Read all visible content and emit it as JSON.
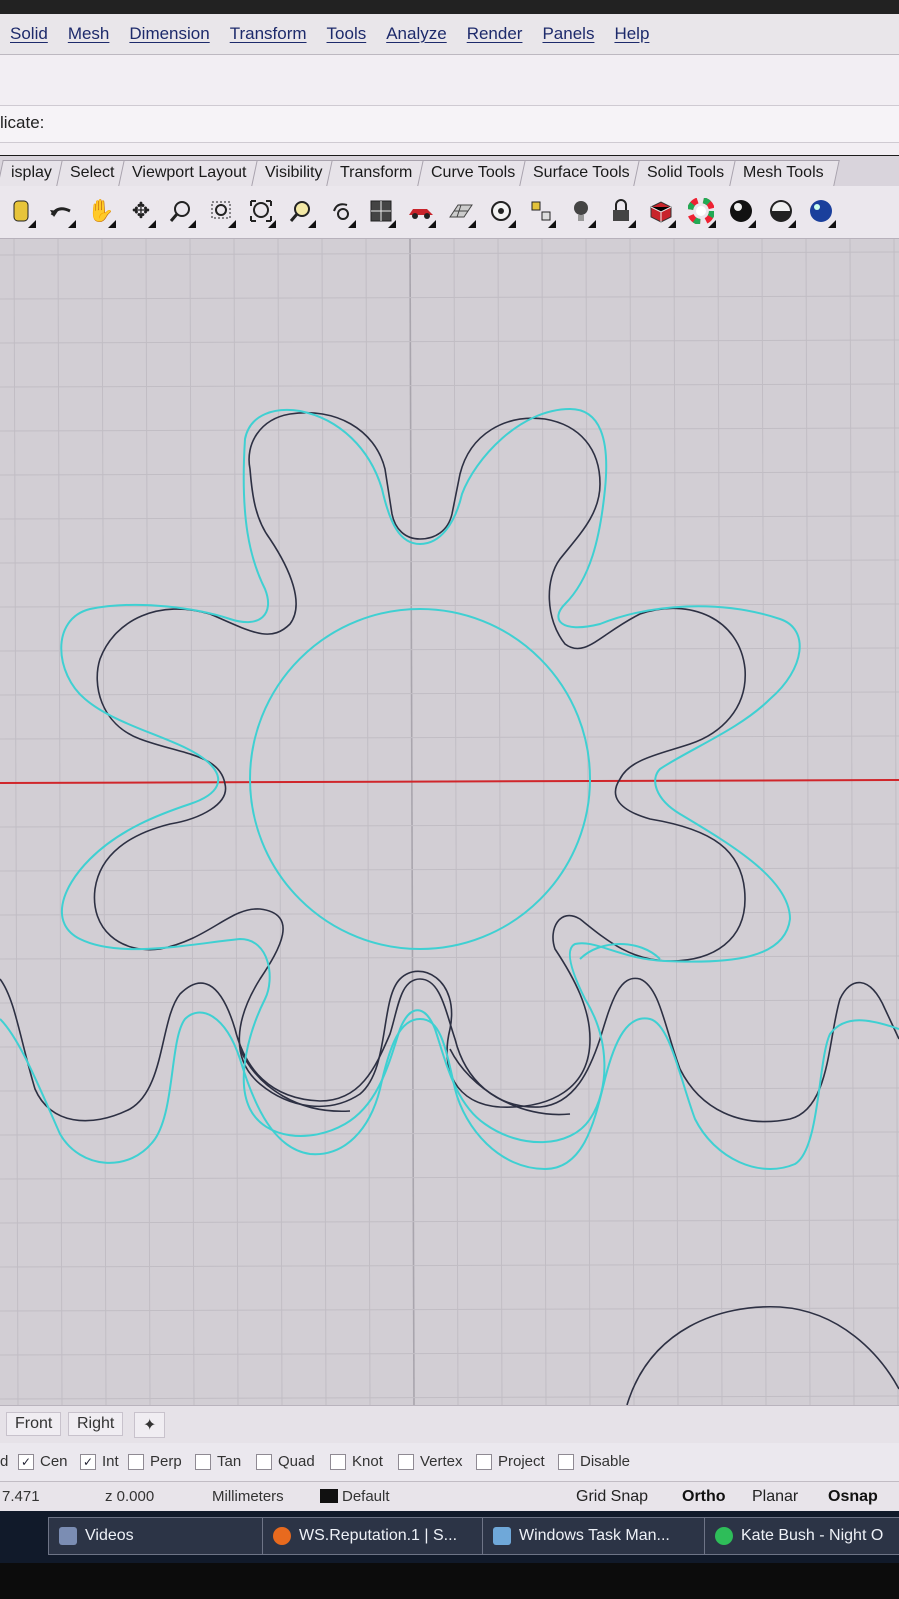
{
  "menu": {
    "items": [
      "Solid",
      "Mesh",
      "Dimension",
      "Transform",
      "Tools",
      "Analyze",
      "Render",
      "Panels",
      "Help"
    ]
  },
  "command": {
    "prompt": "licate:"
  },
  "toolbar_tabs": [
    "isplay",
    "Select",
    "Viewport Layout",
    "Visibility",
    "Transform",
    "Curve Tools",
    "Surface Tools",
    "Solid Tools",
    "Mesh Tools"
  ],
  "toolbar_icons": [
    "new-icon",
    "undo-icon",
    "pan-hand-icon",
    "rotate-view-icon",
    "zoom-dynamic-icon",
    "zoom-window-icon",
    "zoom-extents-icon",
    "zoom-selected-icon",
    "undo-view-icon",
    "four-viewports-icon",
    "car-shaded-icon",
    "mesh-grid-icon",
    "circle-options-icon",
    "cplane-icon",
    "lightbulb-icon",
    "lock-icon",
    "box-render-icon",
    "color-wheel-icon",
    "sphere-black-icon",
    "sphere-white-icon",
    "sphere-blue-icon"
  ],
  "colors": {
    "menu_text": "#1d2a6b",
    "viewport_bg": "#d2ced4",
    "grid_minor": "#c1bdc4",
    "grid_major": "#a9a5ad",
    "x_axis": "#d0262b",
    "curve_cyan": "#3fd0d2",
    "curve_dark": "#2d3043"
  },
  "view_tabs": [
    "Front",
    "Right"
  ],
  "osnap": {
    "lead": "d",
    "items": [
      {
        "label": "Cen",
        "checked": true
      },
      {
        "label": "Int",
        "checked": true
      },
      {
        "label": "Perp",
        "checked": false
      },
      {
        "label": "Tan",
        "checked": false
      },
      {
        "label": "Quad",
        "checked": false
      },
      {
        "label": "Knot",
        "checked": false
      },
      {
        "label": "Vertex",
        "checked": false
      },
      {
        "label": "Project",
        "checked": false
      },
      {
        "label": "Disable",
        "checked": false
      }
    ]
  },
  "status": {
    "coord_x": "7.471",
    "coord_z": "z 0.000",
    "units": "Millimeters",
    "layer": "Default",
    "grid_snap": "Grid Snap",
    "ortho": "Ortho",
    "planar": "Planar",
    "osnap": "Osnap"
  },
  "taskbar": [
    {
      "label": "Videos",
      "icon": "folder-icon",
      "color": "#7b8db3"
    },
    {
      "label": "WS.Reputation.1 | S...",
      "icon": "firefox-icon",
      "color": "#e86a1e"
    },
    {
      "label": "Windows Task Man...",
      "icon": "task-manager-icon",
      "color": "#6fa8d9"
    },
    {
      "label": "Kate Bush - Night O",
      "icon": "spotify-icon",
      "color": "#2ebd59"
    }
  ]
}
